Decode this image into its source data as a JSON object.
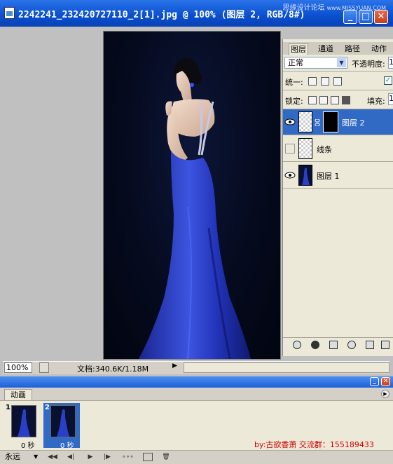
{
  "window": {
    "title": "2242241_232420727110_2[1].jpg @ 100% (图层 2, RGB/8#)",
    "watermark": "思缘设计论坛",
    "watermark_url": "www.MISSYUAN.COM"
  },
  "status": {
    "zoom": "100%",
    "doc_size": "文档:340.6K/1.18M"
  },
  "layers_panel": {
    "tabs": [
      "图层",
      "通道",
      "路径",
      "动作"
    ],
    "blend_mode": "正常",
    "opacity_label": "不透明度:",
    "opacity_value": "1",
    "unify_label": "统一:",
    "lock_label": "锁定:",
    "fill_label": "填充:",
    "fill_value": "1",
    "layers": [
      {
        "name": "图层 2",
        "visible": true,
        "selected": true
      },
      {
        "name": "线条",
        "visible": false,
        "selected": false
      },
      {
        "name": "图层 1",
        "visible": true,
        "selected": false
      }
    ]
  },
  "animation_panel": {
    "tab": "动画",
    "frames": [
      {
        "number": "1",
        "delay": "0 秒"
      },
      {
        "number": "2",
        "delay": "0 秒"
      }
    ],
    "loop": "永远",
    "credit": "by:古欲香萧 交流群：155189433"
  },
  "colors": {
    "title_bar": "#0a4fd0",
    "selection": "#316ac5",
    "dress_blue": "#2a3fc8",
    "photo_bg": "#050a1e",
    "credit_red": "#d00000"
  }
}
